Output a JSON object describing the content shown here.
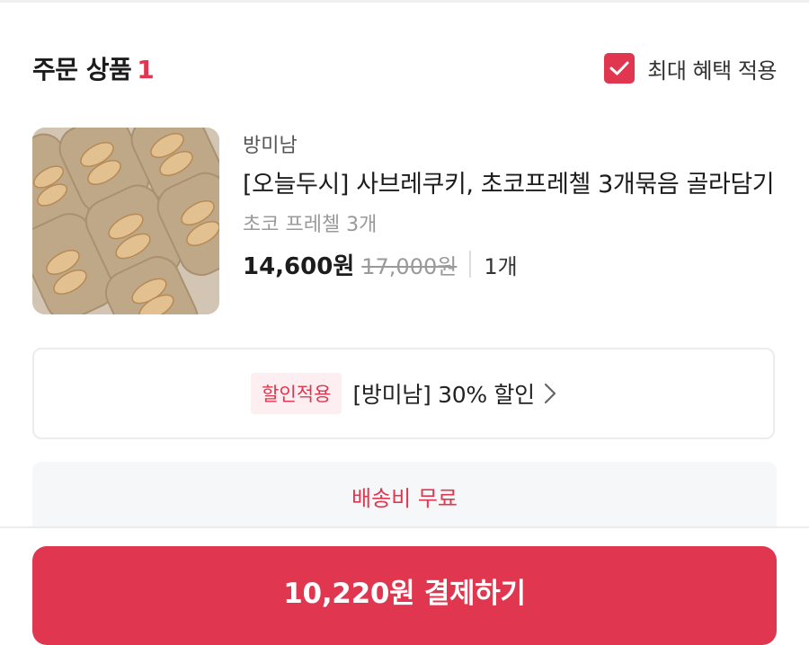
{
  "order_section": {
    "title": "주문 상품",
    "count": "1",
    "benefit_label": "최대 혜택 적용",
    "benefit_checked": true
  },
  "product": {
    "image_icon": "cookie-tray-photo",
    "seller": "방미남",
    "name": "[오늘두시] 사브레쿠키, 초코프레첼 3개묶음 골라담기",
    "option": "초코 프레첼 3개",
    "price": "14,600원",
    "original_price": "17,000원",
    "quantity": "1개"
  },
  "discount": {
    "tag": "할인적용",
    "text": "[방미남] 30% 할인",
    "icon": "chevron-right-icon"
  },
  "shipping": {
    "label": "배송비 무료"
  },
  "checkout": {
    "label": "10,220원 결제하기"
  },
  "colors": {
    "accent": "#e0364f",
    "tag_bg": "#fdeff1",
    "muted_text": "#9a9a9a",
    "shipping_bg": "#f6f7f9"
  }
}
